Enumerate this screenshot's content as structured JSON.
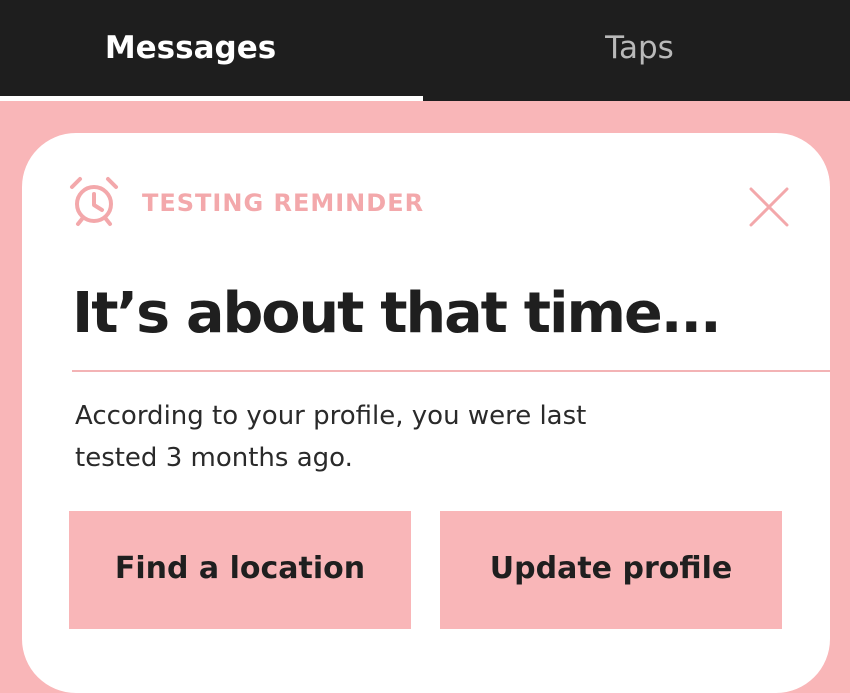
{
  "tabs": {
    "messages_label": "Messages",
    "taps_label": "Taps",
    "active": "Messages"
  },
  "card": {
    "icon": "alarm-clock-icon",
    "reminder_label": "TESTING REMINDER",
    "close_icon": "close-icon",
    "headline": "It’s about that time...",
    "body_line_1": "According to your profile, you were last",
    "body_line_2": "tested 3 months ago.",
    "primary_button": "Find a location",
    "secondary_button": "Update profile"
  },
  "colors": {
    "background_pink": "#f9b6b8",
    "accent_pink": "#f3a8ab",
    "tabbar": "#1e1e1e",
    "text_dark": "#1f1f1f"
  }
}
